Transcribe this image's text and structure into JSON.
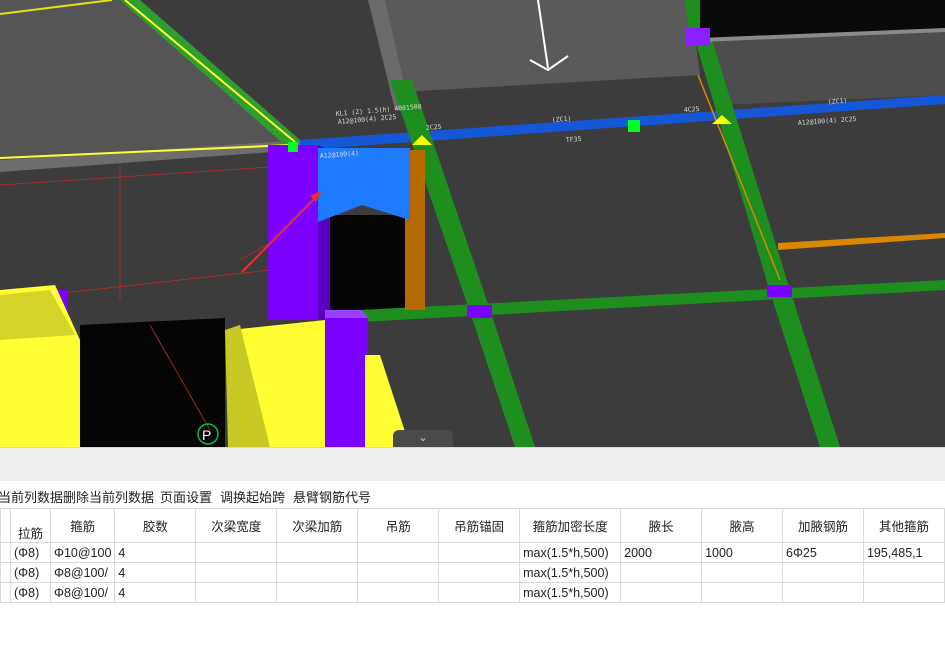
{
  "viewport": {
    "marker_label": "P",
    "collapse_glyph": "⌄",
    "beam_annotations": [
      "KL1 (Z) 1.5(h) 4001500",
      "A12@100(4) 2C25",
      "(ZC1)",
      "(ZC1)",
      "2C25",
      "4C25",
      "A12@100(4) 2C25",
      "A12@100(4)",
      "TF35"
    ]
  },
  "toolbar": {
    "items": [
      "当前列数据",
      "删除当前列数据",
      "页面设置",
      "调换起始跨",
      "悬臂钢筋代号"
    ]
  },
  "table": {
    "columns": [
      "拉筋",
      "箍筋",
      "胶数",
      "次梁宽度",
      "次梁加筋",
      "吊筋",
      "吊筋锚固",
      "箍筋加密长度",
      "腋长",
      "腋高",
      "加腋钢筋",
      "其他箍筋"
    ],
    "rows": [
      [
        "(Φ8)",
        "Φ10@100",
        "4",
        "",
        "",
        "",
        "",
        "max(1.5*h,500)",
        "2000",
        "1000",
        "6Φ25",
        "195,485,1"
      ],
      [
        "(Φ8)",
        "Φ8@100/",
        "4",
        "",
        "",
        "",
        "",
        "max(1.5*h,500)",
        "",
        "",
        "",
        ""
      ],
      [
        "(Φ8)",
        "Φ8@100/",
        "4",
        "",
        "",
        "",
        "",
        "max(1.5*h,500)",
        "",
        "",
        "",
        ""
      ]
    ]
  },
  "colors": {
    "viewport_bg": "#3c3c3c",
    "column_purple": "#7b00ff",
    "beam_green": "#1e8f1e",
    "beam_blue": "#1557d6",
    "slab_yellow": "#ffff33",
    "selection_blue": "#1e7bff",
    "arrow_red": "#e53030"
  }
}
